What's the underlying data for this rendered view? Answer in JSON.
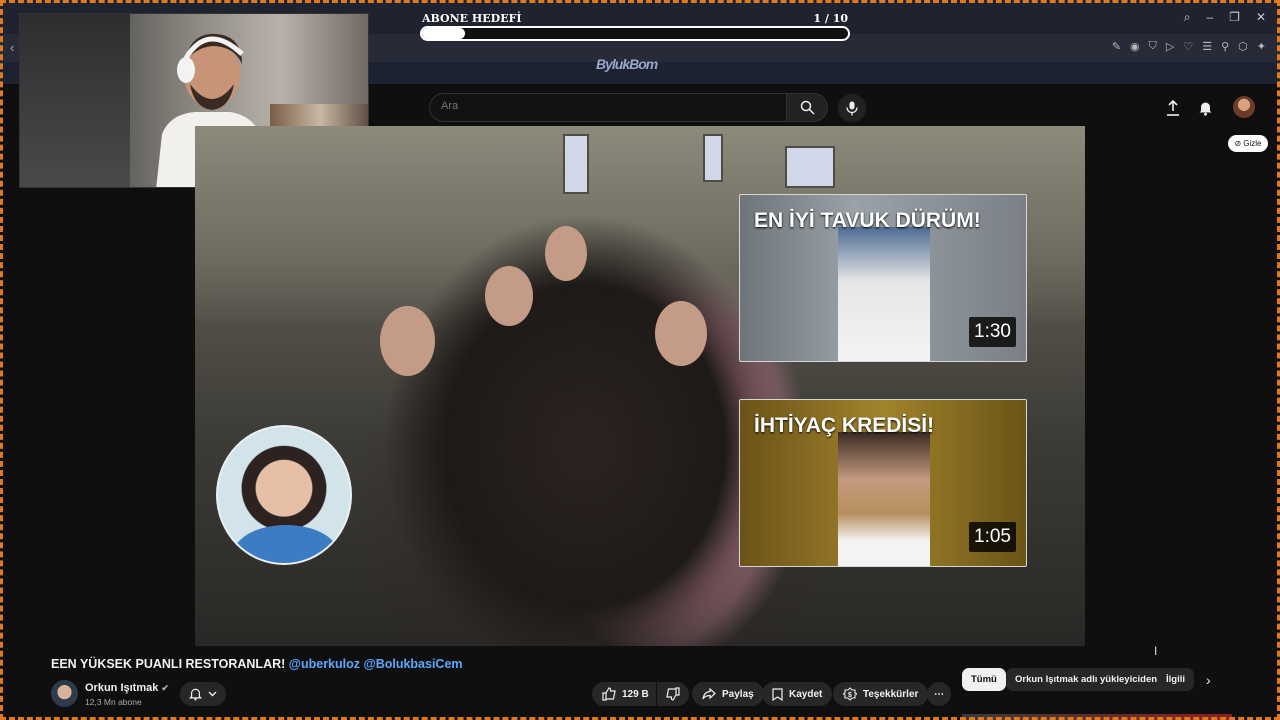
{
  "overlay": {
    "goal_title": "ABONE HEDEFİ",
    "goal_count": "1  / 10",
    "goal_progress": 0.1,
    "logo_text": "BylukBom"
  },
  "youtube": {
    "search_placeholder": "Ara",
    "hide_label": "Gizle"
  },
  "endcards": [
    {
      "title": "EN İYİ TAVUK DÜRÜM!",
      "duration": "1:30"
    },
    {
      "title": "İHTİYAÇ KREDİSİ!",
      "duration": "1:05"
    }
  ],
  "video": {
    "title_text": "EEN YÜKSEK PUANLI RESTORANLAR!",
    "tag1": "@uberkuloz",
    "tag2": "@BolukbasiCem",
    "channel_name": "Orkun Işıtmak",
    "channel_subs": "12,3 Mn abone",
    "likes": "129 B",
    "share_label": "Paylaş",
    "save_label": "Kaydet",
    "thanks_label": "Teşekkürler"
  },
  "chips": [
    {
      "label": "Tümü",
      "active": true
    },
    {
      "label": "Orkun Işıtmak adlı yükleyiciden",
      "active": false
    },
    {
      "label": "İlgili",
      "active": false
    }
  ],
  "colors": {
    "frame_border": "#e07a1f",
    "link_blue": "#5aa8ff",
    "background": "#0f0f0f"
  }
}
